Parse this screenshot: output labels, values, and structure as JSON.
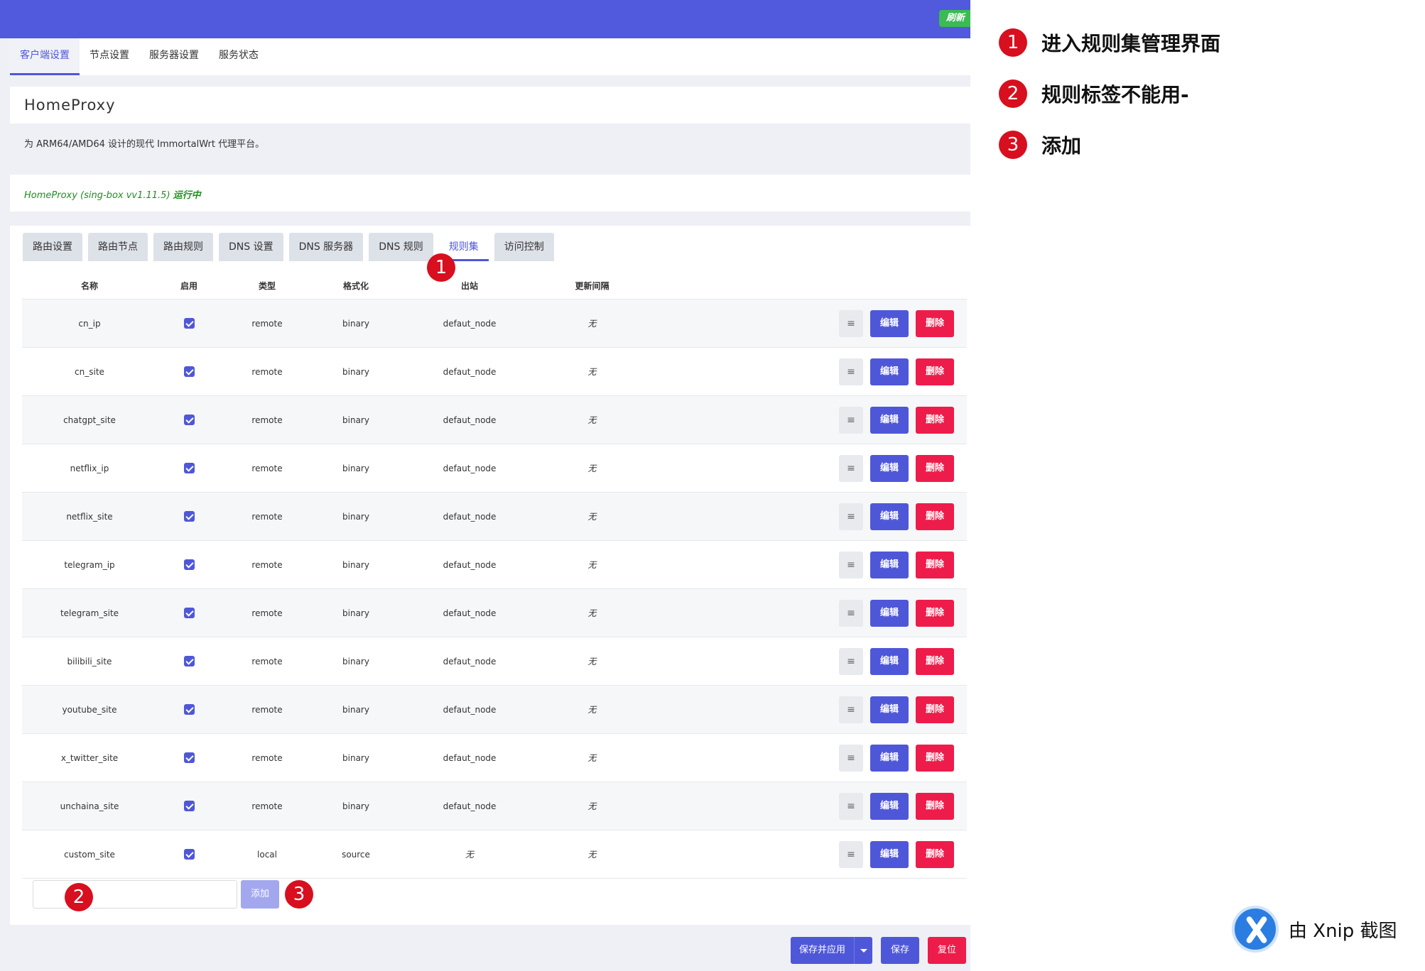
{
  "topbar": {
    "refresh_label": "刷新"
  },
  "nav_tabs": [
    {
      "label": "客户端设置",
      "active": true
    },
    {
      "label": "节点设置",
      "active": false
    },
    {
      "label": "服务器设置",
      "active": false
    },
    {
      "label": "服务状态",
      "active": false
    }
  ],
  "page": {
    "title": "HomeProxy",
    "description": "为 ARM64/AMD64 设计的现代 ImmortalWrt 代理平台。",
    "status_prefix": "HomeProxy (sing-box vv1.11.5)",
    "status_state": "运行中"
  },
  "sub_tabs": [
    {
      "label": "路由设置",
      "active": false
    },
    {
      "label": "路由节点",
      "active": false
    },
    {
      "label": "路由规则",
      "active": false
    },
    {
      "label": "DNS 设置",
      "active": false
    },
    {
      "label": "DNS 服务器",
      "active": false
    },
    {
      "label": "DNS 规则",
      "active": false
    },
    {
      "label": "规则集",
      "active": true
    },
    {
      "label": "访问控制",
      "active": false
    }
  ],
  "table": {
    "headers": {
      "name": "名称",
      "enabled": "启用",
      "type": "类型",
      "format": "格式化",
      "outbound": "出站",
      "interval": "更新间隔"
    },
    "rows": [
      {
        "name": "cn_ip",
        "enabled": true,
        "type": "remote",
        "format": "binary",
        "outbound": "defaut_node",
        "interval": "无"
      },
      {
        "name": "cn_site",
        "enabled": true,
        "type": "remote",
        "format": "binary",
        "outbound": "defaut_node",
        "interval": "无"
      },
      {
        "name": "chatgpt_site",
        "enabled": true,
        "type": "remote",
        "format": "binary",
        "outbound": "defaut_node",
        "interval": "无"
      },
      {
        "name": "netflix_ip",
        "enabled": true,
        "type": "remote",
        "format": "binary",
        "outbound": "defaut_node",
        "interval": "无"
      },
      {
        "name": "netflix_site",
        "enabled": true,
        "type": "remote",
        "format": "binary",
        "outbound": "defaut_node",
        "interval": "无"
      },
      {
        "name": "telegram_ip",
        "enabled": true,
        "type": "remote",
        "format": "binary",
        "outbound": "defaut_node",
        "interval": "无"
      },
      {
        "name": "telegram_site",
        "enabled": true,
        "type": "remote",
        "format": "binary",
        "outbound": "defaut_node",
        "interval": "无"
      },
      {
        "name": "bilibili_site",
        "enabled": true,
        "type": "remote",
        "format": "binary",
        "outbound": "defaut_node",
        "interval": "无"
      },
      {
        "name": "youtube_site",
        "enabled": true,
        "type": "remote",
        "format": "binary",
        "outbound": "defaut_node",
        "interval": "无"
      },
      {
        "name": "x_twitter_site",
        "enabled": true,
        "type": "remote",
        "format": "binary",
        "outbound": "defaut_node",
        "interval": "无"
      },
      {
        "name": "unchaina_site",
        "enabled": true,
        "type": "remote",
        "format": "binary",
        "outbound": "defaut_node",
        "interval": "无"
      },
      {
        "name": "custom_site",
        "enabled": true,
        "type": "local",
        "format": "source",
        "outbound": "无",
        "interval": "无"
      }
    ],
    "row_actions": {
      "drag": "≡",
      "edit": "编辑",
      "delete": "删除"
    }
  },
  "add_row": {
    "input_value": "",
    "button_label": "添加"
  },
  "footer": {
    "save_apply": "保存并应用",
    "save": "保存",
    "reset": "复位"
  },
  "markers": {
    "m1": "1",
    "m2": "2",
    "m3": "3"
  },
  "annotations": [
    {
      "number": "1",
      "text": "进入规则集管理界面"
    },
    {
      "number": "2",
      "text": "规则标签不能用-"
    },
    {
      "number": "3",
      "text": "添加"
    }
  ],
  "watermark": {
    "text": "由 Xnip 截图"
  },
  "colors": {
    "primary": "#4f57d9",
    "danger": "#ee1c4a",
    "success": "#3cba54",
    "marker": "#d70f1e",
    "topbar": "#5159dd"
  }
}
